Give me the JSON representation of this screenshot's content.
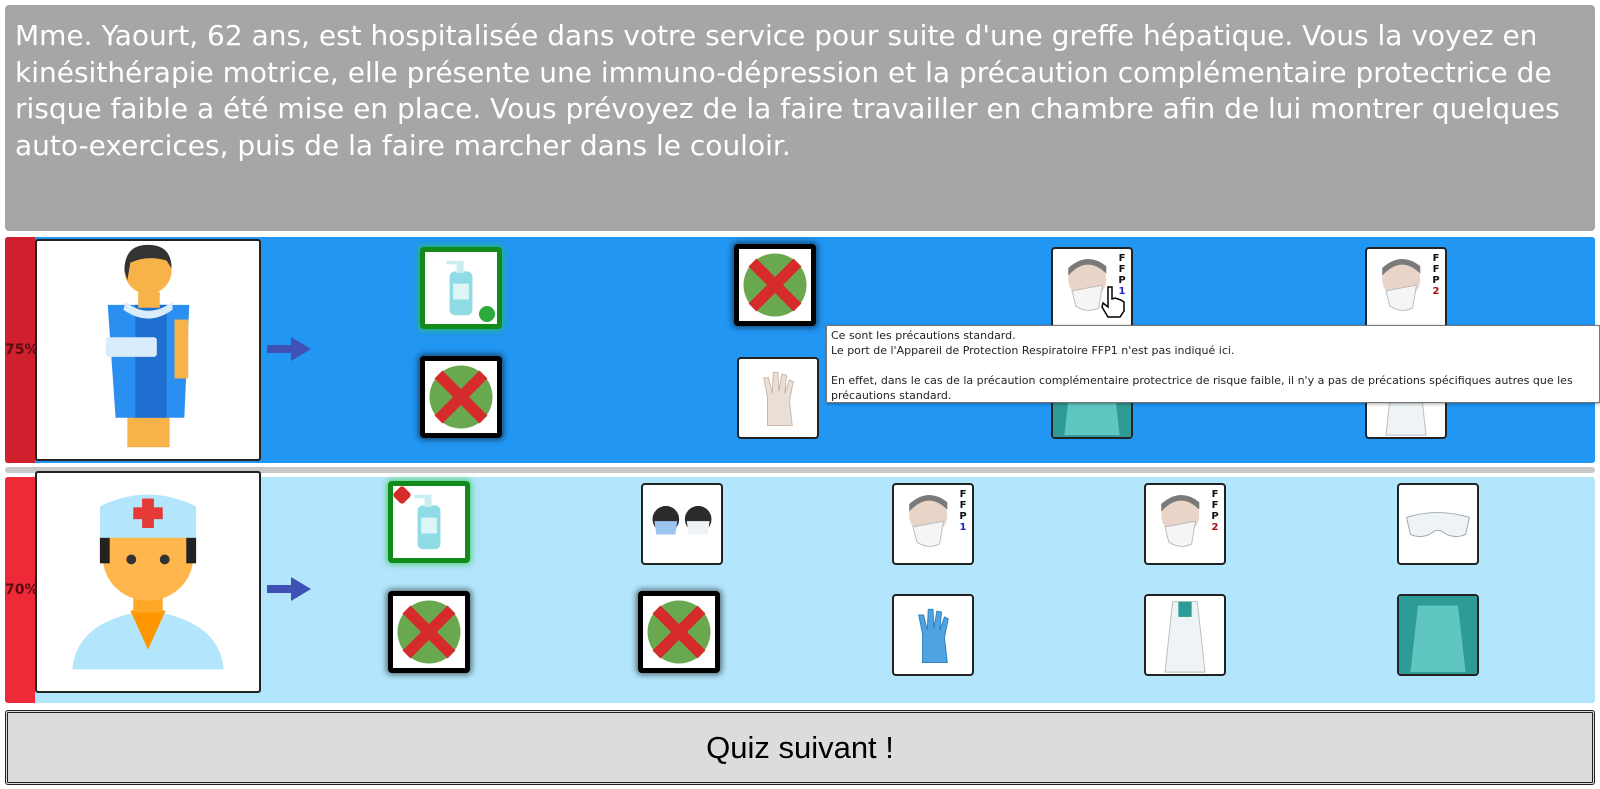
{
  "question": {
    "text": "Mme. Yaourt, 62 ans, est hospitalisée dans votre service pour suite d'une greffe hépatique. Vous la voyez en kinésithérapie motrice, elle présente une immuno-dépression et la précaution complémentaire protectrice de risque faible a été mise en place. Vous prévoyez de la faire travailler en chambre afin de lui montrer quelques auto-exercices, puis de la faire marcher dans le couloir."
  },
  "patient_row": {
    "score": "75%",
    "avatar_icon": "patient-icon",
    "bg_color": "#2196f3"
  },
  "carer_row": {
    "score": "70%",
    "avatar_icon": "nurse-icon",
    "bg_color": "#b3e5fc"
  },
  "ffp_labels": {
    "f": "F",
    "p": "P",
    "one": "1",
    "two": "2"
  },
  "tooltip": {
    "line1": "Ce sont les précautions standard.",
    "line2": "Le port de l'Appareil de Protection Respiratoire FFP1 n'est pas indiqué ici.",
    "line3": "En effet, dans le cas de la précaution complémentaire protectrice de risque faible, il n'y a pas de précations spécifiques autres que les précautions standard."
  },
  "next_button": {
    "label": "Quiz suivant !"
  },
  "colors": {
    "ok": "#138a1c",
    "wrong": "#d62b2b",
    "question_bg": "#a6a6a6"
  }
}
